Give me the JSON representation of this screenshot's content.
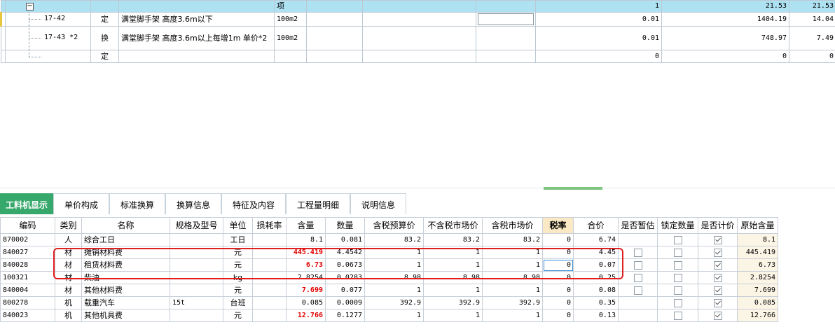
{
  "top_table": {
    "header_row": {
      "type": "项",
      "qty": "1",
      "price": "21.53",
      "total": "21.53"
    },
    "rows": [
      {
        "code": "17-42",
        "type": "定",
        "name": "满堂脚手架 高度3.6m以下",
        "unit": "100m2",
        "qty": "0.01",
        "price": "1404.19",
        "total": "14.04"
      },
      {
        "code": "17-43 *2",
        "type": "换",
        "name": "满堂脚手架 高度3.6m以上每增1m  单价*2",
        "unit": "100m2",
        "qty": "0.01",
        "price": "748.97",
        "total": "7.49"
      },
      {
        "code": "",
        "type": "定",
        "name": "",
        "unit": "",
        "qty": "0",
        "price": "0",
        "total": "0"
      }
    ]
  },
  "tabs": [
    {
      "label": "工料机显示",
      "active": true
    },
    {
      "label": "单价构成"
    },
    {
      "label": "标准换算"
    },
    {
      "label": "换算信息"
    },
    {
      "label": "特征及内容"
    },
    {
      "label": "工程量明细"
    },
    {
      "label": "说明信息"
    }
  ],
  "grid": {
    "headers": [
      "编码",
      "类别",
      "名称",
      "规格及型号",
      "单位",
      "损耗率",
      "含量",
      "数量",
      "含税预算价",
      "不含税市场价",
      "含税市场价",
      "税率",
      "合价",
      "是否暂估",
      "锁定数量",
      "是否计价",
      "原始含量"
    ],
    "rows": [
      {
        "code": "870002",
        "cat": "人",
        "name": "综合工日",
        "spec": "",
        "unit": "工日",
        "loss": "",
        "content": "8.1",
        "content_red": false,
        "qty": "0.081",
        "tax_budget": "83.2",
        "notax_market": "83.2",
        "tax_market": "83.2",
        "rate": "0",
        "total": "6.74",
        "est": null,
        "lock": false,
        "priced": true,
        "orig": "8.1"
      },
      {
        "code": "840027",
        "cat": "材",
        "name": "摊销材料费",
        "spec": "",
        "unit": "元",
        "loss": "",
        "content": "445.419",
        "content_red": true,
        "qty": "4.4542",
        "tax_budget": "1",
        "notax_market": "1",
        "tax_market": "1",
        "rate": "0",
        "total": "4.45",
        "est": false,
        "lock": false,
        "priced": true,
        "orig": "445.419"
      },
      {
        "code": "840028",
        "cat": "材",
        "name": "租赁材料费",
        "spec": "",
        "unit": "元",
        "loss": "",
        "content": "6.73",
        "content_red": true,
        "qty": "0.0673",
        "tax_budget": "1",
        "notax_market": "1",
        "tax_market": "1",
        "rate": "0",
        "total": "0.07",
        "est": false,
        "lock": false,
        "priced": true,
        "orig": "6.73"
      },
      {
        "code": "100321",
        "cat": "材",
        "name": "柴油",
        "spec": "",
        "unit": "kg",
        "loss": "",
        "content": "2.8254",
        "content_red": false,
        "qty": "0.0283",
        "tax_budget": "8.98",
        "notax_market": "8.98",
        "tax_market": "8.98",
        "rate": "0",
        "total": "0.25",
        "est": false,
        "lock": false,
        "priced": true,
        "orig": "2.8254"
      },
      {
        "code": "840004",
        "cat": "材",
        "name": "其他材料费",
        "spec": "",
        "unit": "元",
        "loss": "",
        "content": "7.699",
        "content_red": true,
        "qty": "0.077",
        "tax_budget": "1",
        "notax_market": "1",
        "tax_market": "1",
        "rate": "0",
        "total": "0.08",
        "est": false,
        "lock": false,
        "priced": true,
        "orig": "7.699"
      },
      {
        "code": "800278",
        "cat": "机",
        "name": "载重汽车",
        "spec": "15t",
        "unit": "台班",
        "loss": "",
        "content": "0.085",
        "content_red": false,
        "qty": "0.0009",
        "tax_budget": "392.9",
        "notax_market": "392.9",
        "tax_market": "392.9",
        "rate": "0",
        "total": "0.35",
        "est": null,
        "lock": false,
        "priced": true,
        "orig": "0.085"
      },
      {
        "code": "840023",
        "cat": "机",
        "name": "其他机具费",
        "spec": "",
        "unit": "元",
        "loss": "",
        "content": "12.766",
        "content_red": true,
        "qty": "0.1277",
        "tax_budget": "1",
        "notax_market": "1",
        "tax_market": "1",
        "rate": "0",
        "total": "0.13",
        "est": null,
        "lock": false,
        "priced": true,
        "orig": "12.766"
      }
    ]
  },
  "colors": {
    "accent_tab": "#37a86b",
    "header_blue": "#aee2f3",
    "highlight_red": "#e02020",
    "rate_header": "#fbe9c6"
  }
}
